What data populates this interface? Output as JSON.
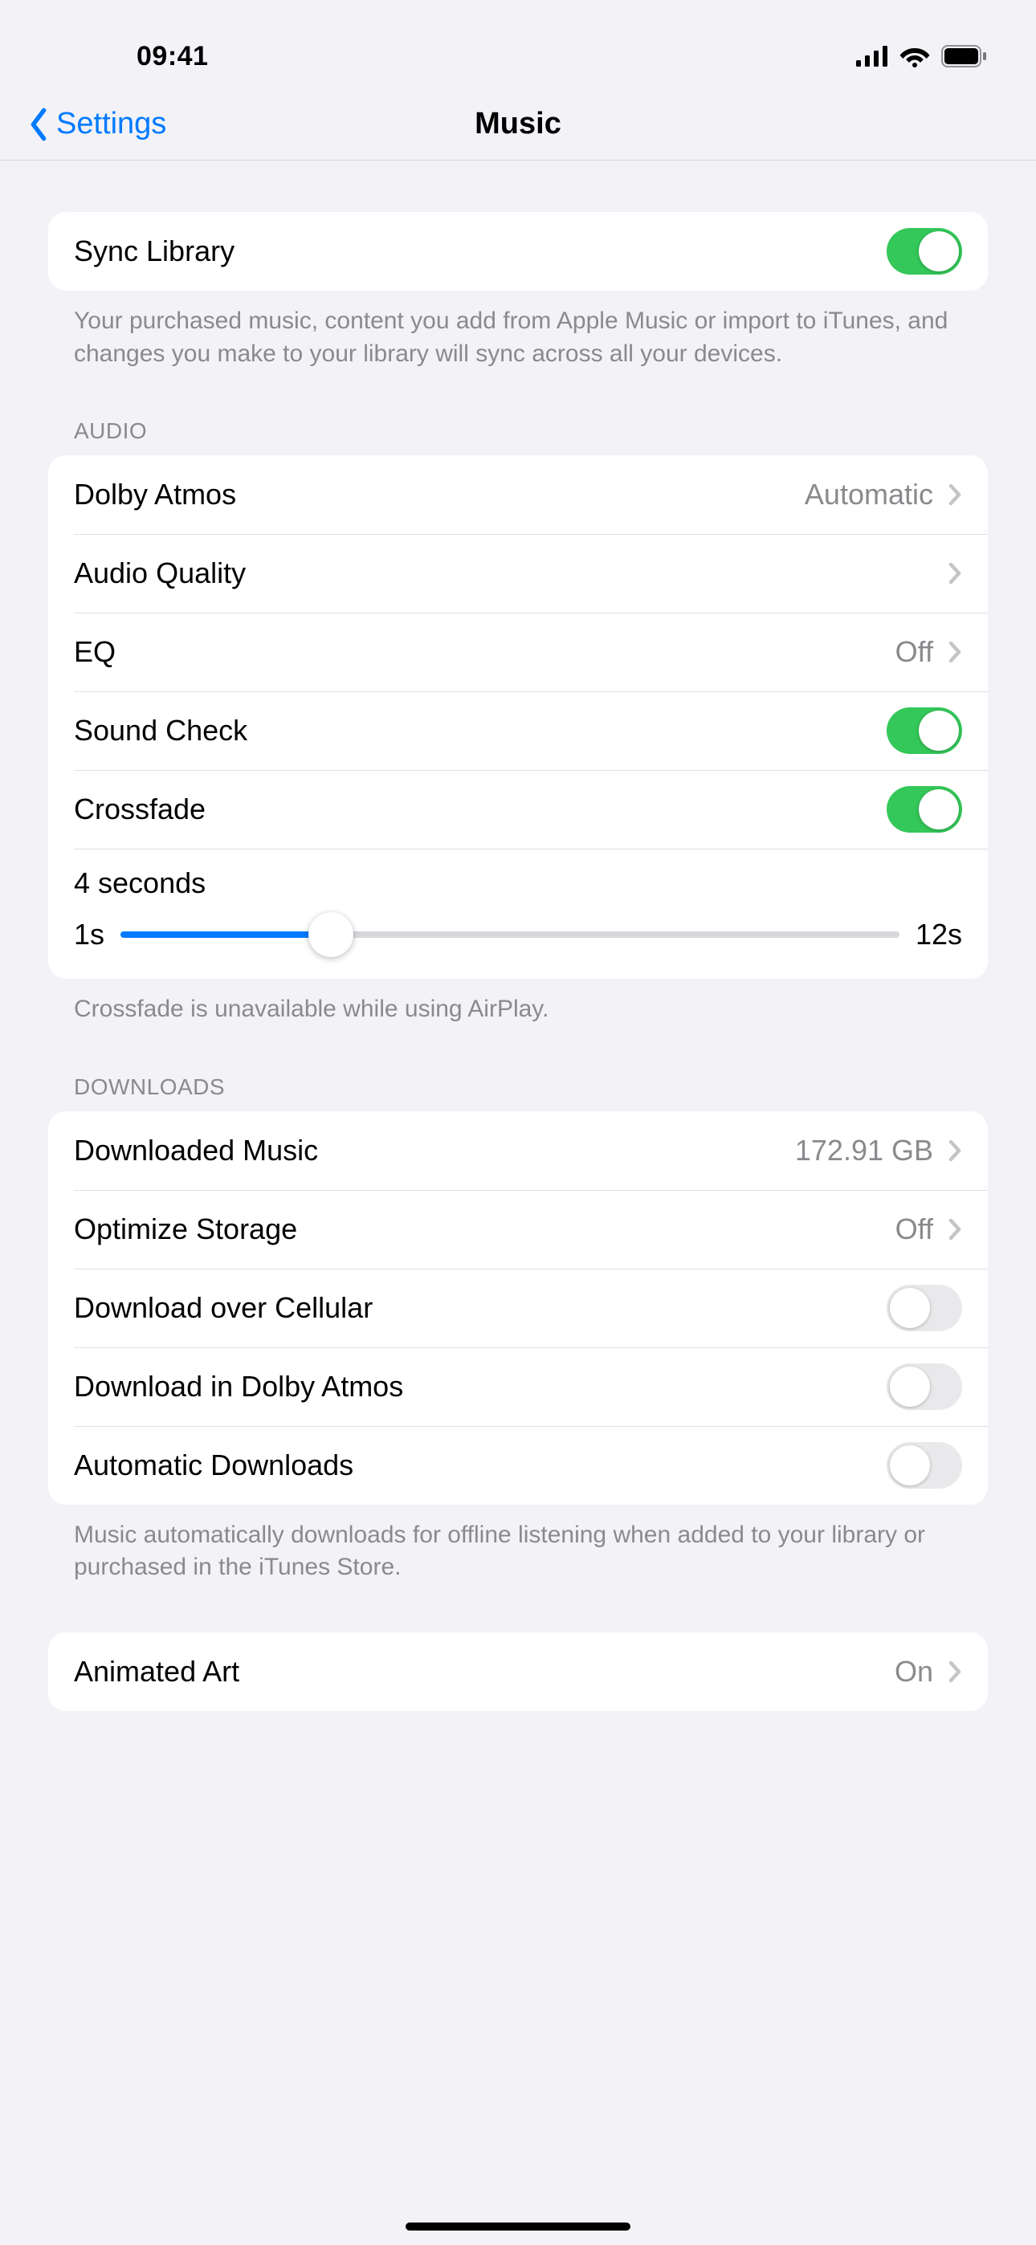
{
  "status": {
    "time": "09:41"
  },
  "nav": {
    "back_label": "Settings",
    "title": "Music"
  },
  "sync": {
    "label": "Sync Library",
    "on": true,
    "footer": "Your purchased music, content you add from Apple Music or import to iTunes, and changes you make to your library will sync across all your devices."
  },
  "audio": {
    "header": "AUDIO",
    "dolby_label": "Dolby Atmos",
    "dolby_value": "Automatic",
    "quality_label": "Audio Quality",
    "eq_label": "EQ",
    "eq_value": "Off",
    "sound_check_label": "Sound Check",
    "sound_check_on": true,
    "crossfade_label": "Crossfade",
    "crossfade_on": true,
    "crossfade_current": "4 seconds",
    "crossfade_min": "1s",
    "crossfade_max": "12s",
    "crossfade_percent": 27,
    "footer": "Crossfade is unavailable while using AirPlay."
  },
  "downloads": {
    "header": "DOWNLOADS",
    "downloaded_label": "Downloaded Music",
    "downloaded_value": "172.91 GB",
    "optimize_label": "Optimize Storage",
    "optimize_value": "Off",
    "cellular_label": "Download over Cellular",
    "cellular_on": false,
    "dolby_dl_label": "Download in Dolby Atmos",
    "dolby_dl_on": false,
    "auto_label": "Automatic Downloads",
    "auto_on": false,
    "footer": "Music automatically downloads for offline listening when added to your library or purchased in the iTunes Store."
  },
  "animated": {
    "label": "Animated Art",
    "value": "On"
  }
}
